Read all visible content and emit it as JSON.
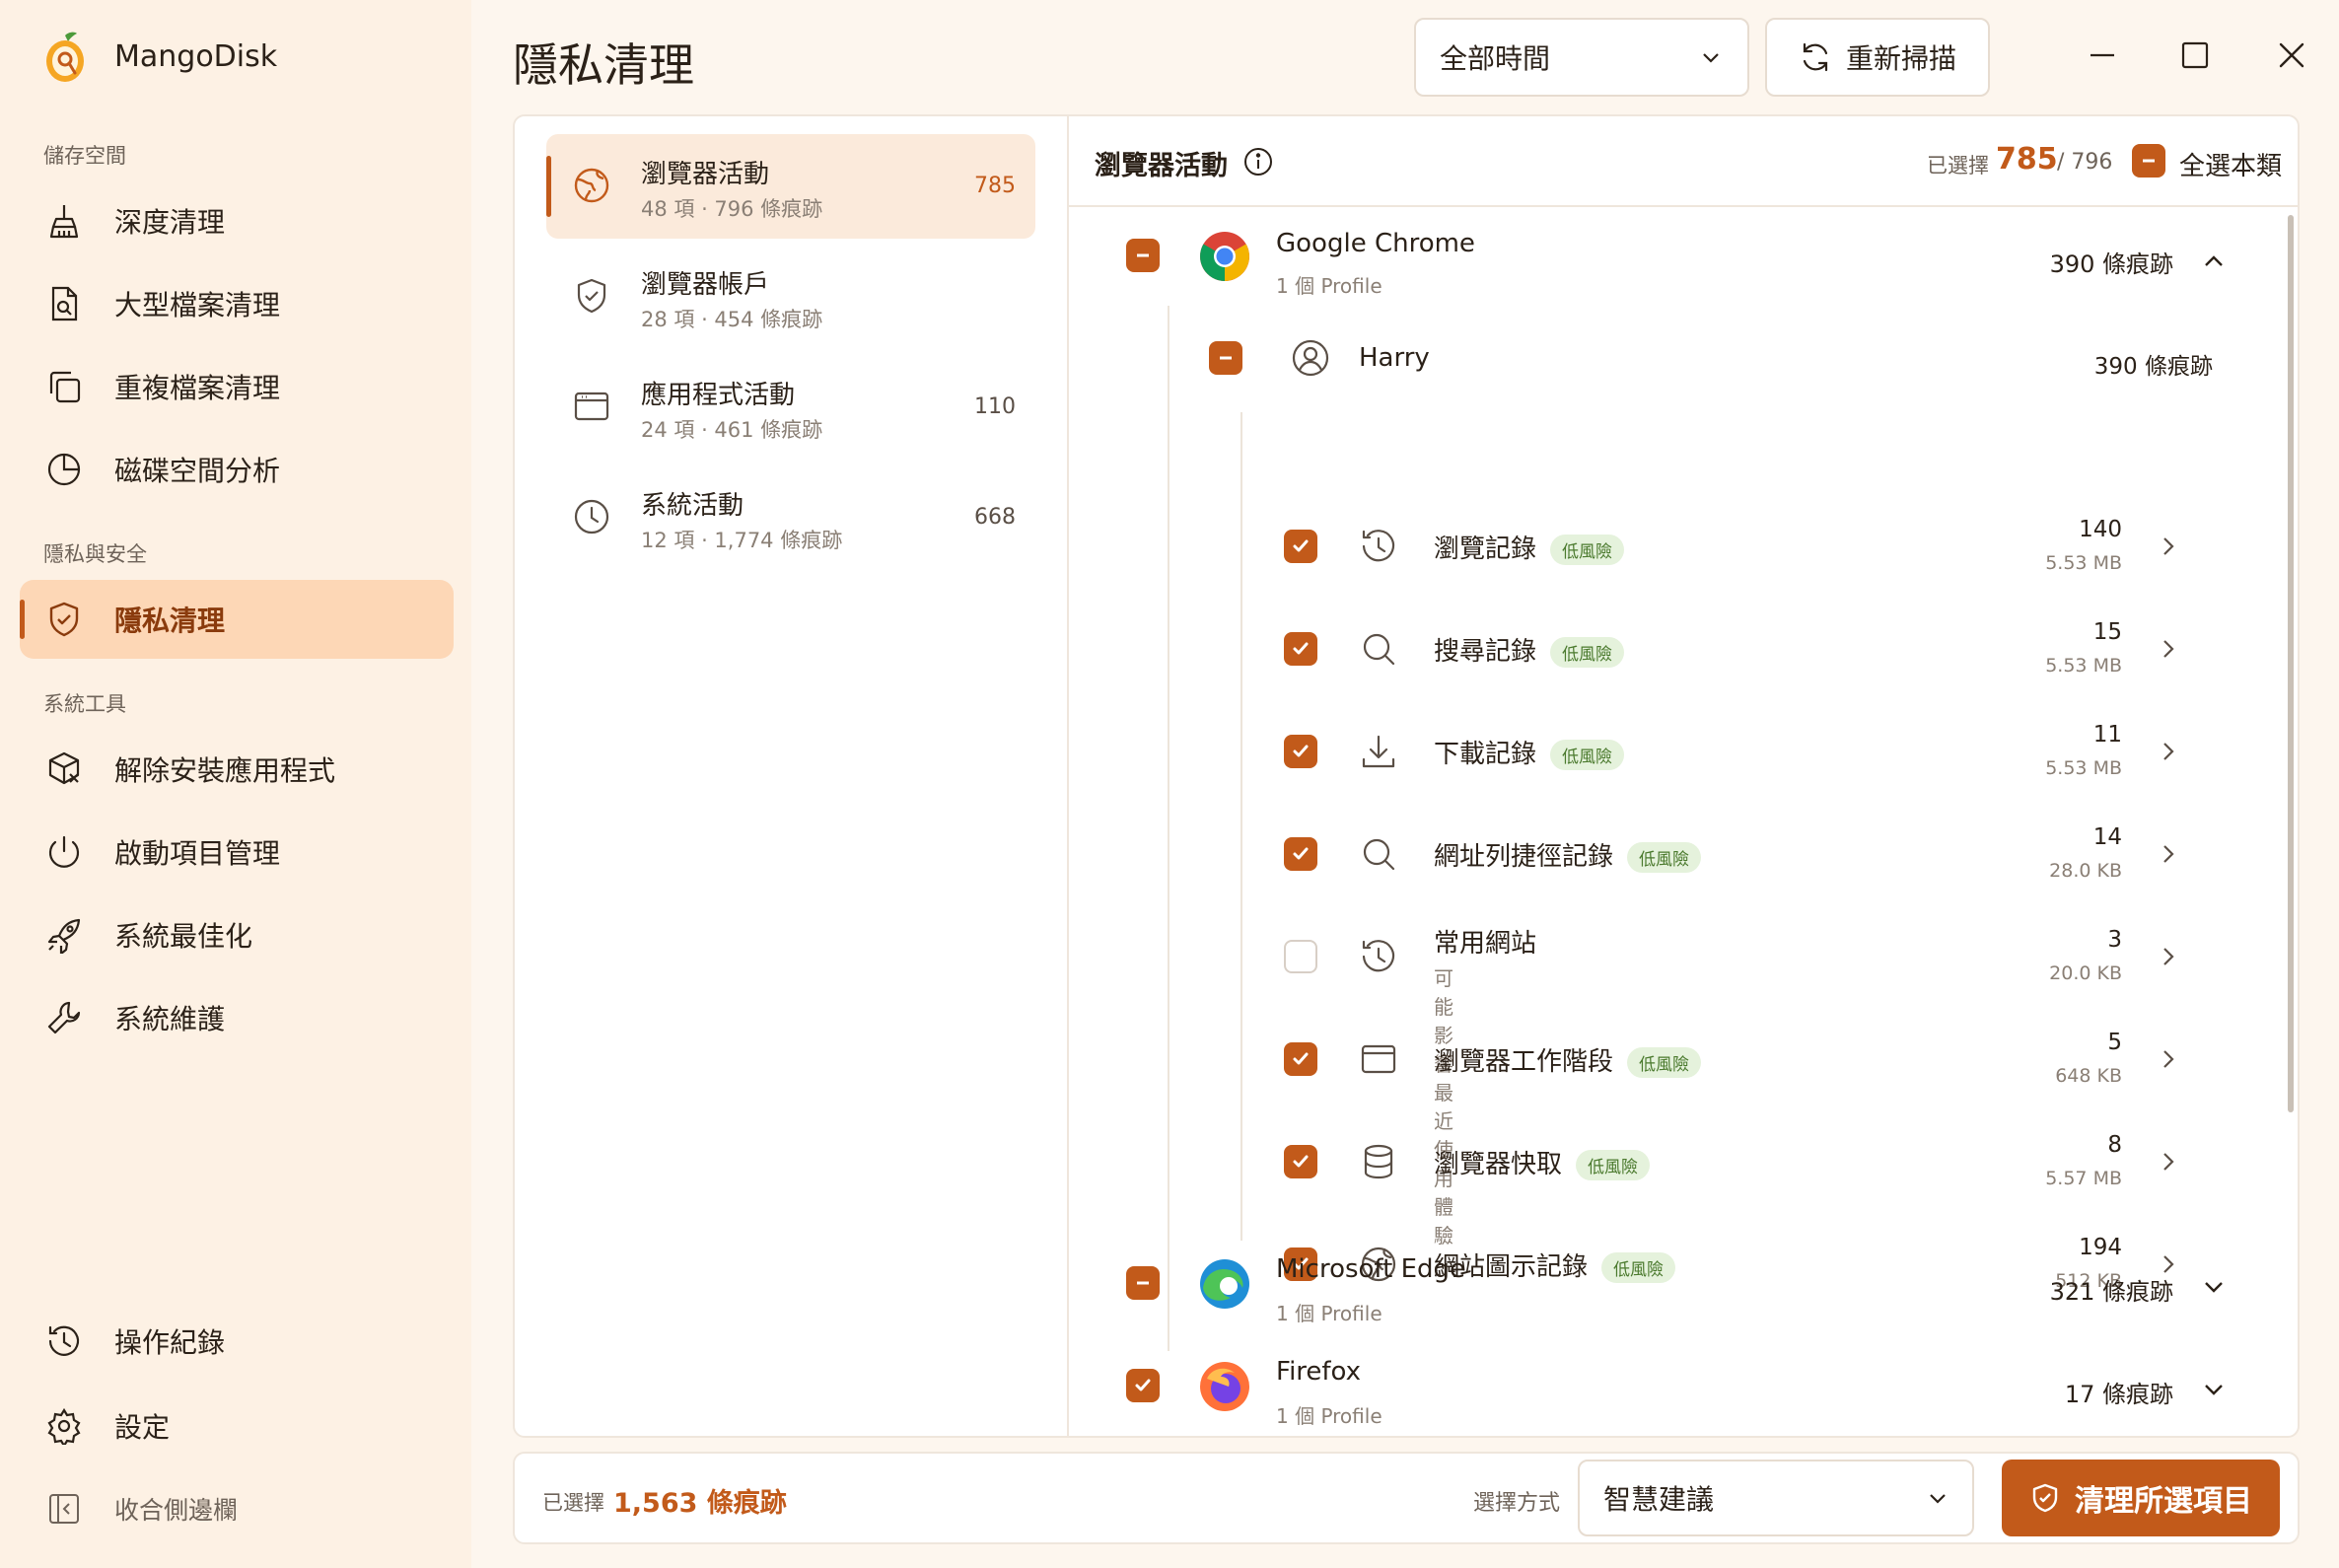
{
  "app": {
    "title": "MangoDisk"
  },
  "sidebar": {
    "sections": [
      {
        "title": "儲存空間"
      },
      {
        "title": "隱私與安全"
      },
      {
        "title": "系統工具"
      }
    ],
    "items": [
      {
        "label": "深度清理",
        "icon": "broom-icon"
      },
      {
        "label": "大型檔案清理",
        "icon": "file-search-icon"
      },
      {
        "label": "重複檔案清理",
        "icon": "copy-icon"
      },
      {
        "label": "磁碟空間分析",
        "icon": "pie-chart-icon"
      },
      {
        "label": "隱私清理",
        "icon": "shield-check-icon",
        "active": true
      },
      {
        "label": "解除安裝應用程式",
        "icon": "package-remove-icon"
      },
      {
        "label": "啟動項目管理",
        "icon": "power-icon"
      },
      {
        "label": "系統最佳化",
        "icon": "rocket-icon"
      },
      {
        "label": "系統維護",
        "icon": "wrench-icon"
      }
    ],
    "bottom": [
      {
        "label": "操作紀錄",
        "icon": "history-icon"
      },
      {
        "label": "設定",
        "icon": "gear-icon"
      },
      {
        "label": "收合側邊欄",
        "icon": "sidebar-collapse-icon"
      }
    ]
  },
  "header": {
    "title": "隱私清理",
    "time_filter": "全部時間",
    "rescan_label": "重新掃描"
  },
  "categories": [
    {
      "title": "瀏覽器活動",
      "subtitle": "48 項 · 796 條痕跡",
      "count": "785",
      "active": true
    },
    {
      "title": "瀏覽器帳戶",
      "subtitle": "28 項 · 454 條痕跡",
      "count": ""
    },
    {
      "title": "應用程式活動",
      "subtitle": "24 項 · 461 條痕跡",
      "count": "110"
    },
    {
      "title": "系統活動",
      "subtitle": "12 項 · 1,774 條痕跡",
      "count": "668"
    }
  ],
  "detail": {
    "title": "瀏覽器活動",
    "selected_label": "已選擇",
    "selected_count": "785",
    "total": "/ 796",
    "select_all_label": "全選本類",
    "browsers": [
      {
        "name": "Google Chrome",
        "profiles": "1 個 Profile",
        "traces": "390 條痕跡",
        "state": "partial",
        "expanded": true
      },
      {
        "name": "Microsoft Edge",
        "profiles": "1 個 Profile",
        "traces": "321 條痕跡",
        "state": "partial",
        "expanded": false
      },
      {
        "name": "Firefox",
        "profiles": "1 個 Profile",
        "traces": "17 條痕跡",
        "state": "checked",
        "expanded": false
      }
    ],
    "profile": {
      "name": "Harry",
      "traces": "390 條痕跡"
    },
    "items": [
      {
        "label": "瀏覽記錄",
        "risk": "低風險",
        "count": "140",
        "size": "5.53 MB",
        "checked": true,
        "icon": "history-icon"
      },
      {
        "label": "搜尋記錄",
        "risk": "低風險",
        "count": "15",
        "size": "5.53 MB",
        "checked": true,
        "icon": "search-icon"
      },
      {
        "label": "下載記錄",
        "risk": "低風險",
        "count": "11",
        "size": "5.53 MB",
        "checked": true,
        "icon": "download-icon"
      },
      {
        "label": "網址列捷徑記錄",
        "risk": "低風險",
        "count": "14",
        "size": "28.0 KB",
        "checked": true,
        "icon": "search-icon"
      },
      {
        "label": "常用網站",
        "risk": "",
        "note": "可能影響最近使用體驗",
        "count": "3",
        "size": "20.0 KB",
        "checked": false,
        "icon": "history-icon"
      },
      {
        "label": "瀏覽器工作階段",
        "risk": "低風險",
        "count": "5",
        "size": "648 KB",
        "checked": true,
        "icon": "browser-window-icon"
      },
      {
        "label": "瀏覽器快取",
        "risk": "低風險",
        "count": "8",
        "size": "5.57 MB",
        "checked": true,
        "icon": "database-icon"
      },
      {
        "label": "網站圖示記錄",
        "risk": "低風險",
        "count": "194",
        "size": "512 KB",
        "checked": true,
        "icon": "globe-icon"
      }
    ]
  },
  "footer": {
    "selected_label": "已選擇",
    "selected_value": "1,563 條痕跡",
    "mode_label": "選擇方式",
    "mode_value": "智慧建議",
    "clean_label": "清理所選項目"
  },
  "colors": {
    "accent": "#c25a1a",
    "background": "#fdf6ee",
    "active_nav": "#fdd7b6"
  }
}
